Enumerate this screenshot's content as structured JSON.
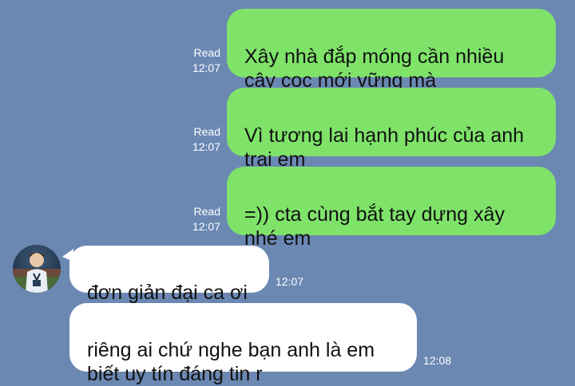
{
  "messages": [
    {
      "direction": "outgoing",
      "text": "Xây nhà đắp móng cần nhiều\ncây cọc mới vững mà",
      "status": "Read",
      "time": "12:07"
    },
    {
      "direction": "outgoing",
      "text": "Vì tương lai hạnh phúc của anh\ntrai em",
      "status": "Read",
      "time": "12:07"
    },
    {
      "direction": "outgoing",
      "text": "=)) cta cùng bắt tay dựng xây\nnhé em",
      "status": "Read",
      "time": "12:07"
    },
    {
      "direction": "incoming",
      "text": "đơn giản đại ca ơi",
      "time": "12:07"
    },
    {
      "direction": "incoming",
      "text": "riêng ai chứ nghe bạn anh là em\nbiết uy tín đáng tin r",
      "time": "12:08"
    }
  ],
  "colors": {
    "background": "#6b88b3",
    "outgoing_bubble": "#7fe36a",
    "incoming_bubble": "#ffffff",
    "meta_text": "#ffffff"
  },
  "icons": {
    "contact_avatar": "avatar"
  }
}
